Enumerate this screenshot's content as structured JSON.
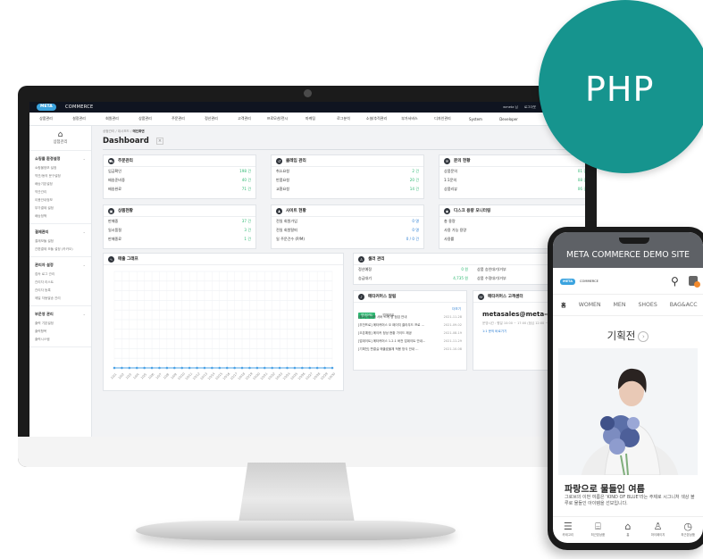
{
  "admin": {
    "brand_pill": "META",
    "brand_word": "COMMERCE",
    "top_links": [
      "wmeta 님",
      "로그아웃",
      "관리자 매뉴얼",
      "관리자"
    ],
    "menu": [
      "상품관리",
      "설정관리",
      "회원관리",
      "상품관리",
      "주문관리",
      "정산관리",
      "고객관리",
      "프로모션/전시",
      "마케팅",
      "로그분석",
      "소셜/추적관리",
      "부가서비스",
      "디자인관리",
      "System",
      "Developer"
    ],
    "home_label": "상점관리",
    "sidebar": [
      {
        "head": "쇼핑몰 환경설정",
        "items": [
          "쇼핑몰정보 설정",
          "약관/동의 문구설정",
          "배송기본설정",
          "약관관리",
          "이용안내정보",
          "부가결제 설정",
          "배송정책"
        ]
      },
      {
        "head": "결제관리",
        "items": [
          "결제모듈 설정",
          "간편결제 모듈 설정 (카카오)"
        ]
      },
      {
        "head": "관리자 설정",
        "items": [
          "접속 로그 관리",
          "관리자 리스트",
          "관리자 등록",
          "메일 자동발송 관리"
        ]
      },
      {
        "head": "부운영 관리",
        "items": [
          "출력 기본설정",
          "출력항목",
          "출력시스템"
        ]
      }
    ],
    "breadcrumb": [
      "상점관리",
      "대시보드",
      "메인화면"
    ],
    "dashboard_title": "Dashboard",
    "cards": {
      "order": {
        "title": "주문관리",
        "rows": [
          {
            "label": "입금확인",
            "value": "198 건"
          },
          {
            "label": "배송준비중",
            "value": "40 건"
          },
          {
            "label": "배송완료",
            "value": "71 건"
          }
        ]
      },
      "claim": {
        "title": "클레임 관리",
        "rows": [
          {
            "label": "취소요청",
            "value": "2 건"
          },
          {
            "label": "반품요청",
            "value": "20 건"
          },
          {
            "label": "교환요청",
            "value": "14 건"
          }
        ]
      },
      "inquiry": {
        "title": "문의 현황",
        "rows": [
          {
            "label": "상품문의",
            "value": "01 건"
          },
          {
            "label": "1:1문의",
            "value": "08 건"
          },
          {
            "label": "상품리뷰",
            "value": "06 건"
          }
        ]
      },
      "product": {
        "title": "상품현황",
        "rows": [
          {
            "label": "판매중",
            "value": "37 건"
          },
          {
            "label": "일시품절",
            "value": "3 건"
          },
          {
            "label": "판매종료",
            "value": "1 건"
          }
        ]
      },
      "site": {
        "title": "사이트 현황",
        "rows": [
          {
            "label": "전일 회원가입",
            "value": "0 명"
          },
          {
            "label": "전일 회원탈퇴",
            "value": "0 명"
          },
          {
            "label": "일 주문건수 (P/M)",
            "value": "0 / 0 건"
          }
        ]
      },
      "disk": {
        "title": "디스크 용량 모니터링",
        "rows": [
          {
            "label": "총 용량",
            "value": ""
          },
          {
            "label": "사용 가능 용량",
            "value": ""
          },
          {
            "label": "사용률",
            "value": ""
          }
        ]
      },
      "seller": {
        "title": "셀러 관리",
        "rows": [
          {
            "label": "정산예정",
            "value": "0 원"
          },
          {
            "label": "승급대기",
            "value": "4,735 원"
          }
        ],
        "rows2": [
          {
            "label": "상품 승인대기/거부",
            "value": ""
          },
          {
            "label": "상품 수정대기/거부",
            "value": ""
          }
        ]
      },
      "sales": {
        "title": "매출 그래프"
      },
      "notice": {
        "title": "메타커머스 알림",
        "tab_active": "업데이트",
        "tab_other": "업데이트",
        "more": "더보기",
        "rows": [
          {
            "text": "[중요] 메이커 서버 스케 정 점검 안내",
            "date": "2021-11-28"
          },
          {
            "text": "[추천프로] 메타커머스 오 페이지 클라우드 프로 ...",
            "date": "2021-09-02"
          },
          {
            "text": "[오픈예정] 메이커 정상 현황 가이드 제공",
            "date": "2021-08-19"
          },
          {
            "text": "[업데이트] 메타커머스 1.2.1 버전 업데이트 안내...",
            "date": "2021-11-29"
          },
          {
            "text": "[기획전] 편결실 매출효율체 적용 방식 안내 ...",
            "date": "2021-10-08"
          }
        ]
      },
      "contact": {
        "title": "메타커머스 고객센터",
        "email": "metasales@meta-comm",
        "sub": "운영시간 : 평일 10:00 ~ 17:00 (점심 12:00 ~ 13:00)",
        "link": "1:1 문의 바로가기"
      }
    }
  },
  "chart_data": {
    "type": "line",
    "title": "매출 그래프",
    "categories": [
      "10/1",
      "10/2",
      "10/3",
      "10/4",
      "10/5",
      "10/6",
      "10/7",
      "10/8",
      "10/9",
      "10/10",
      "10/11",
      "10/12",
      "10/13",
      "10/14",
      "10/15",
      "10/16",
      "10/17",
      "10/18",
      "10/19",
      "10/20",
      "10/21",
      "10/22",
      "10/23",
      "10/24",
      "10/25",
      "10/26",
      "10/27",
      "10/28",
      "10/29",
      "10/30"
    ],
    "series": [
      {
        "values": [
          0,
          0,
          0,
          0,
          0,
          0,
          0,
          0,
          0,
          0,
          0,
          0,
          0,
          0,
          0,
          0,
          0,
          0,
          0,
          0,
          0,
          0,
          0,
          0,
          0,
          0,
          0,
          0,
          0,
          0
        ]
      }
    ],
    "ylim": [
      0,
      1
    ],
    "grid": true
  },
  "badge": {
    "label": "PHP",
    "color": "#16948e"
  },
  "phone": {
    "site_title": "META COMMERCE DEMO SITE",
    "logo_pill": "META",
    "logo_word": "COMMERCE",
    "tabs": [
      "홈",
      "WOMEN",
      "MEN",
      "SHOES",
      "BAG&ACC"
    ],
    "promo_title": "기획전",
    "promo_arrow": "›",
    "headline": "파랑으로 물들인 여름",
    "description": "그로브의 이번 여름은 'KIND OF BLUE'라는 주제로 시그니처 색상 블루로 물들인 아이템을 선보입니다.",
    "nav": [
      {
        "icon": "☰",
        "label": "카테고리"
      },
      {
        "icon": "⌸",
        "label": "최근본상품"
      },
      {
        "icon": "⌂",
        "label": "홈"
      },
      {
        "icon": "♙",
        "label": "마이페이지"
      },
      {
        "icon": "◷",
        "label": "최근본상품"
      }
    ]
  },
  "colors": {
    "accent_green": "#2eb872",
    "accent_blue": "#3ba3df",
    "link_blue": "#2d7fd3"
  }
}
